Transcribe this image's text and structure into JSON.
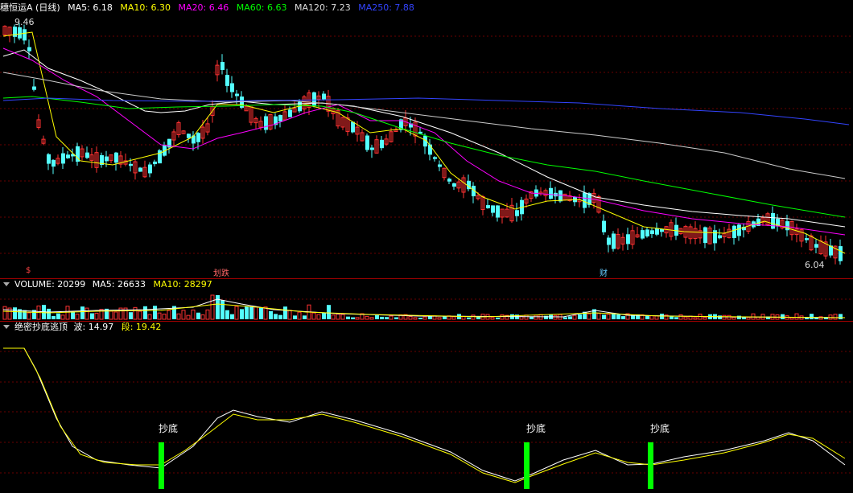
{
  "header": {
    "stock_name": "穗恒运A (日线)",
    "ma": [
      {
        "label": "MA5: 6.18",
        "color": "#ffffff"
      },
      {
        "label": "MA10: 6.30",
        "color": "#ffff00"
      },
      {
        "label": "MA20: 6.46",
        "color": "#ff00ff"
      },
      {
        "label": "MA60: 6.63",
        "color": "#00ff00"
      },
      {
        "label": "MA120: 7.23",
        "color": "#dddddd"
      },
      {
        "label": "MA250: 7.88",
        "color": "#3344ff"
      }
    ]
  },
  "price_panel": {
    "high_label": "9.46",
    "low_label": "6.04",
    "markers": [
      {
        "text": "$",
        "color": "#ff4444"
      },
      {
        "text": "划跌",
        "color": "#ff6666"
      },
      {
        "text": "财",
        "color": "#66ccff"
      }
    ]
  },
  "volume_header": {
    "name": "VOLUME: 20299",
    "ma5": "MA5: 26633",
    "ma10": "MA10: 28297"
  },
  "indicator_header": {
    "name": "绝密抄底逃顶",
    "wave": "波: 14.97",
    "segment": "段: 19.42"
  },
  "signals": [
    "抄底",
    "抄底",
    "抄底"
  ],
  "colors": {
    "up": "#ff3232",
    "down": "#54ffff",
    "grid": "#6a0000"
  }
}
